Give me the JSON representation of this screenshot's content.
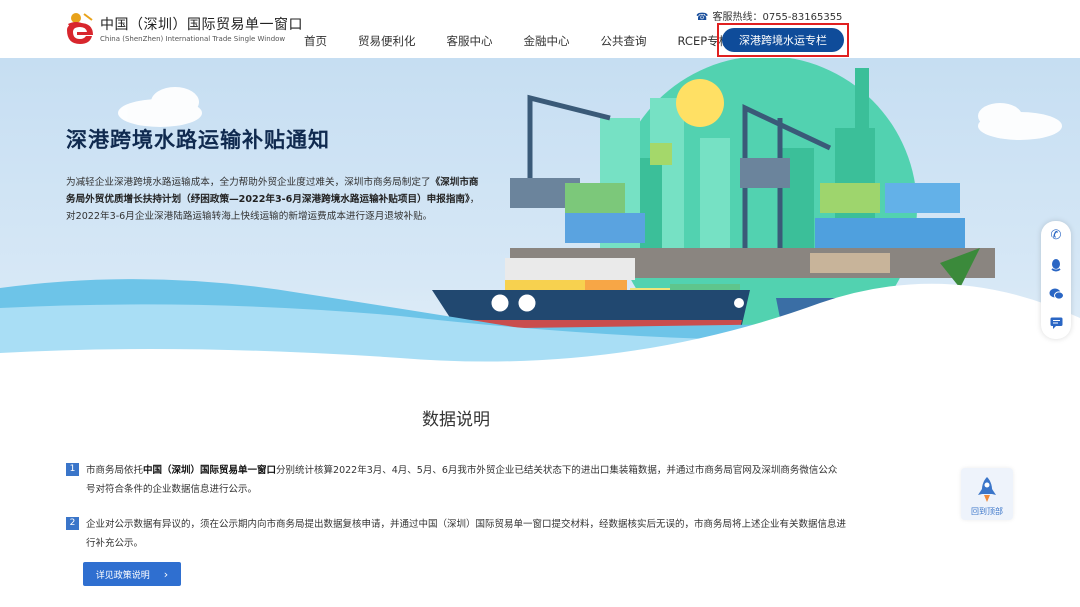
{
  "header": {
    "logo_cn": "中国（深圳）国际贸易单一窗口",
    "logo_en": "China (ShenZhen) International Trade Single Window",
    "hotline": "客服热线：0755-83165355",
    "nav": [
      "首页",
      "贸易便利化",
      "客服中心",
      "金融中心",
      "公共查询",
      "RCEP专栏"
    ],
    "nav_active": "深港跨境水运专栏"
  },
  "hero": {
    "title": "深港跨境水路运输补贴通知",
    "desc_1": "为减轻企业深港跨境水路运输成本，全力帮助外贸企业度过难关，深圳市商务局制定了",
    "desc_bold": "《深圳市商务局外贸优质增长扶持计划（纾困政策—2022年3-6月深港跨境水路运输补贴项目）申报指南》",
    "desc_2": "，对2022年3-6月企业深港陆路运输转海上快线运输的新增运费成本进行逐月退坡补贴。"
  },
  "side_tools": [
    "phone-icon",
    "qq-icon",
    "wechat-icon",
    "message-icon"
  ],
  "data_section": {
    "title": "数据说明",
    "items": [
      {
        "num": "1",
        "pre": "市商务局依托",
        "bold": "中国（深圳）国际贸易单一窗口",
        "post": "分别统计核算2022年3月、4月、5月、6月我市外贸企业已结关状态下的进出口集装箱数据，并通过市商务局官网及深圳商务微信公众号对符合条件的企业数据信息进行公示。"
      },
      {
        "num": "2",
        "text": "企业对公示数据有异议的，须在公示期内向市商务局提出数据复核申请，并通过中国（深圳）国际贸易单一窗口提交材料，经数据核实后无误的，市商务局将上述企业有关数据信息进行补充公示。"
      }
    ],
    "button": "详见政策说明",
    "back_top": "回到顶部"
  }
}
